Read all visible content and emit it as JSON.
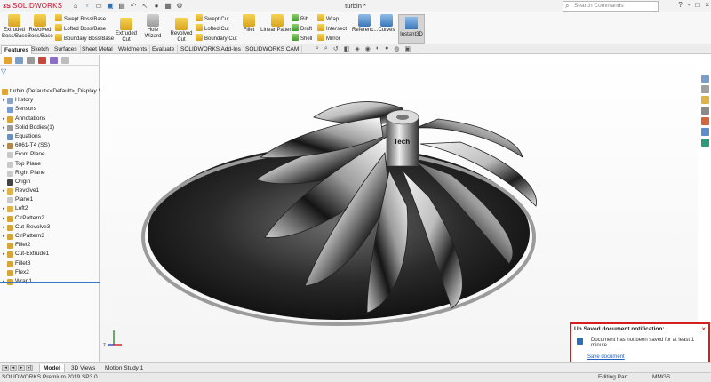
{
  "app": {
    "logo": "SOLIDWORKS",
    "doc_title": "turbin *",
    "search_placeholder": "Search Commands",
    "window_controls": [
      "?",
      "-",
      "□",
      "×"
    ]
  },
  "command_manager": {
    "extruded_boss": [
      "Extruded",
      "Boss/Base"
    ],
    "revolved_boss": [
      "Revolved",
      "Boss/Base"
    ],
    "swept_boss": "Swept Boss/Base",
    "lofted_boss": "Lofted Boss/Base",
    "boundary_boss": "Boundary Boss/Base",
    "extruded_cut": [
      "Extruded",
      "Cut"
    ],
    "hole_wizard": "Hole Wizard",
    "revolved_cut": [
      "Revolved",
      "Cut"
    ],
    "swept_cut": "Swept Cut",
    "lofted_cut": "Lofted Cut",
    "boundary_cut": "Boundary Cut",
    "fillet": "Fillet",
    "linear_pattern": "Linear Pattern",
    "rib": "Rib",
    "draft": "Draft",
    "shell": "Shell",
    "wrap": "Wrap",
    "intersect": "Intersect",
    "mirror": "Mirror",
    "reference": "Referenc...",
    "curves": "Curves",
    "instant3d": "Instant3D"
  },
  "tabs": [
    "Features",
    "Sketch",
    "Surfaces",
    "Sheet Metal",
    "Weldments",
    "Evaluate",
    "SOLIDWORKS Add-Ins",
    "SOLIDWORKS CAM"
  ],
  "feature_tree": [
    {
      "label": "turbin  (Default<<Default>_Display S",
      "icon": "part-icon"
    },
    {
      "label": "History",
      "icon": "history-icon"
    },
    {
      "label": "Sensors",
      "icon": "sensor-icon"
    },
    {
      "label": "Annotations",
      "icon": "annotation-icon"
    },
    {
      "label": "Solid Bodies(1)",
      "icon": "solid-bodies-icon"
    },
    {
      "label": "Equations",
      "icon": "equations-icon"
    },
    {
      "label": "6061-T4 (SS)",
      "icon": "material-icon"
    },
    {
      "label": "Front Plane",
      "icon": "plane-icon"
    },
    {
      "label": "Top Plane",
      "icon": "plane-icon"
    },
    {
      "label": "Right Plane",
      "icon": "plane-icon"
    },
    {
      "label": "Origin",
      "icon": "origin-icon"
    },
    {
      "label": "Revolve1",
      "icon": "revolve-icon"
    },
    {
      "label": "Plane1",
      "icon": "plane-icon"
    },
    {
      "label": "Loft2",
      "icon": "loft-icon"
    },
    {
      "label": "CirPattern2",
      "icon": "pattern-icon"
    },
    {
      "label": "Cut-Revolve3",
      "icon": "cut-revolve-icon"
    },
    {
      "label": "CirPattern3",
      "icon": "pattern-icon"
    },
    {
      "label": "Fillet2",
      "icon": "fillet-icon"
    },
    {
      "label": "Cut-Extrude1",
      "icon": "cut-extrude-icon"
    },
    {
      "label": "Fillet8",
      "icon": "fillet-icon"
    },
    {
      "label": "Flex2",
      "icon": "flex-icon"
    },
    {
      "label": "Wrap1",
      "icon": "wrap-icon"
    }
  ],
  "bottom_tabs": [
    "Model",
    "3D Views",
    "Motion Study 1"
  ],
  "status": {
    "app_version": "SOLIDWORKS Premium 2019 SP3.0",
    "mode": "Editing Part",
    "units": "MMGS"
  },
  "notification": {
    "title": "Un Saved document notification:",
    "message": "Document has not been saved for at least 1 minute.",
    "link": "Save document"
  },
  "model_text": "Tech",
  "colors": {
    "accent": "#2d6fb5",
    "brand_red": "#c8102e",
    "notification_border": "#d41f1f",
    "selection_line": "#3a77c7"
  }
}
